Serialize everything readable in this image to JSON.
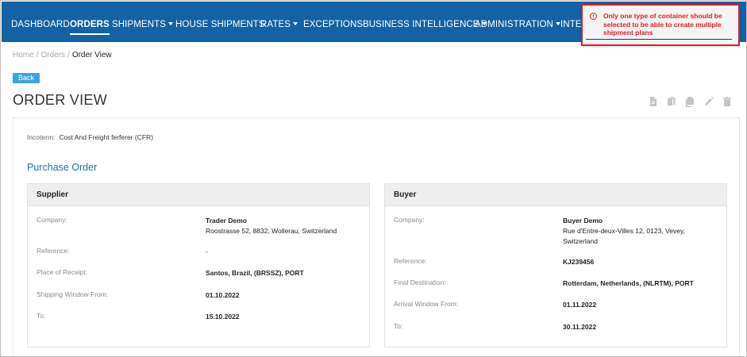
{
  "nav": {
    "items": [
      {
        "label": "DASHBOARD"
      },
      {
        "label": "ORDERS"
      },
      {
        "label": "SHIPMENTS"
      },
      {
        "label": "HOUSE SHIPMENTS"
      },
      {
        "label": "RATES"
      },
      {
        "label": "EXCEPTIONS"
      },
      {
        "label": "BUSINESS INTELLIGENCE"
      },
      {
        "label": "ADMINISTRATION"
      },
      {
        "label": "INTEG"
      }
    ],
    "active": "ORDERS"
  },
  "toast": {
    "message": "Only one type of container should be selected to be able to create multiple shipment plans",
    "accent_color": "#e11b22"
  },
  "breadcrumb": {
    "home": "Home",
    "orders": "Orders",
    "current": "Order View",
    "separator": "/"
  },
  "back_label": "Back",
  "page_title": "ORDER VIEW",
  "actions": [
    "pdf-icon",
    "copy-icon",
    "duplicate-icon",
    "edit-icon",
    "delete-icon"
  ],
  "incoterm": {
    "label": "Incoterm:",
    "value": "Cost And Freight ferferer (CFR)"
  },
  "section_title": "Purchase Order",
  "supplier": {
    "title": "Supplier",
    "company_label": "Company:",
    "company_name": "Trader Demo",
    "company_address": "Roostrasse 52, 8832, Wollerau, Switzerland",
    "reference_label": "Reference:",
    "reference_value": "-",
    "place_label": "Place of Receipt:",
    "place_value": "Santos, Brazil, (BRSSZ), PORT",
    "window_from_label": "Shipping Window From:",
    "window_from_value": "01.10.2022",
    "to_label": "To:",
    "to_value": "15.10.2022"
  },
  "buyer": {
    "title": "Buyer",
    "company_label": "Company:",
    "company_name": "Buyer Demo",
    "company_address_1": "Rue d'Entre-deux-Villes 12, 0123, Vevey,",
    "company_address_2": "Switzerland",
    "reference_label": "Reference:",
    "reference_value": "KJ239456",
    "destination_label": "Final Destination:",
    "destination_value": "Rotterdam, Netherlands, (NLRTM), PORT",
    "arrival_label": "Arrival Window From:",
    "arrival_value": "01.11.2022",
    "to_label": "To:",
    "to_value": "30.11.2022"
  },
  "colors": {
    "navbar": "#1462a3",
    "link": "#1d72b6",
    "back_button": "#3ea3d8"
  }
}
